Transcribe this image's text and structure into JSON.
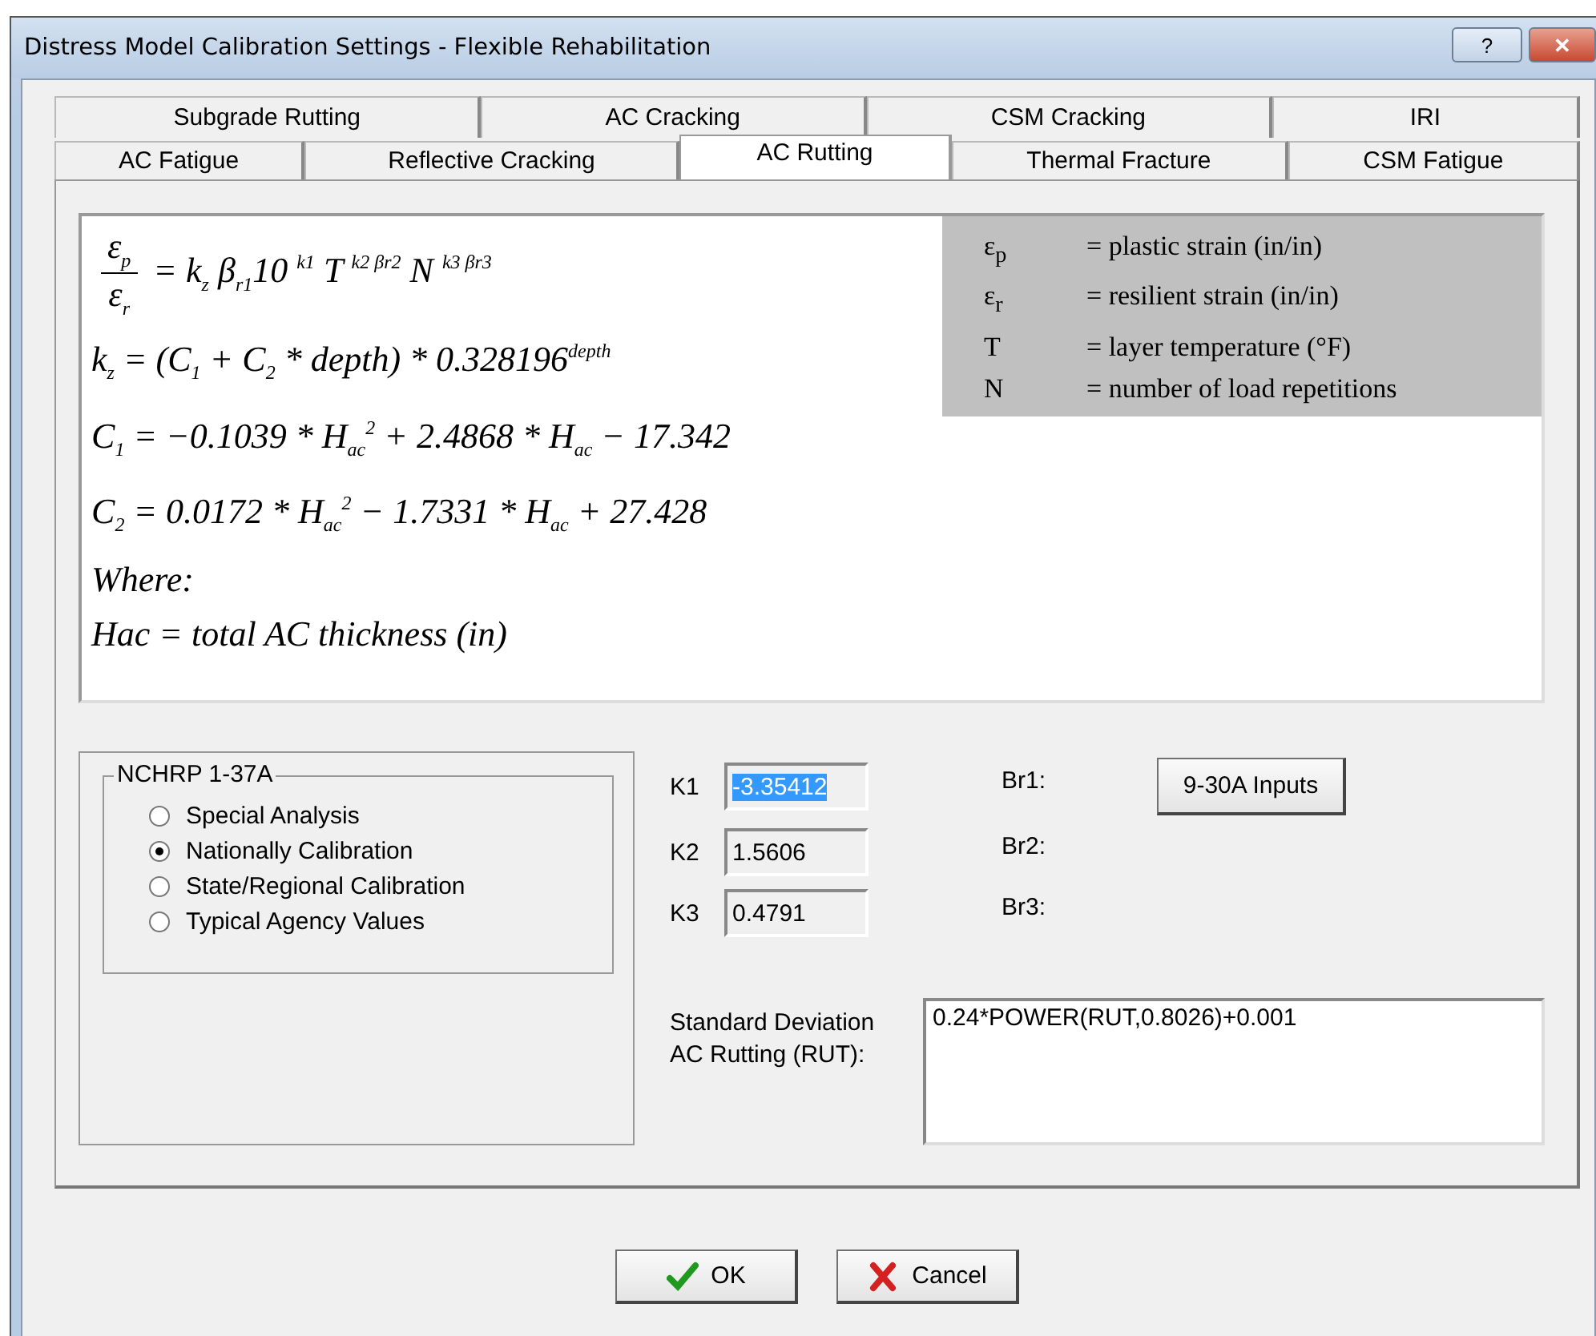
{
  "window": {
    "title": "Distress Model Calibration Settings - Flexible Rehabilitation",
    "buttons": [
      {
        "kind": "help",
        "label": "?"
      },
      {
        "kind": "close",
        "label": "✕"
      }
    ]
  },
  "tab_rows": [
    [
      {
        "label": "Subgrade Rutting",
        "selected": false
      },
      {
        "label": "AC Cracking",
        "selected": false
      },
      {
        "label": "CSM Cracking",
        "selected": false
      },
      {
        "label": "IRI",
        "selected": false
      }
    ],
    [
      {
        "label": "AC Fatigue",
        "selected": false
      },
      {
        "label": "Reflective Cracking",
        "selected": false
      },
      {
        "label": "AC Rutting",
        "selected": true
      },
      {
        "label": "Thermal Fracture",
        "selected": false
      },
      {
        "label": "CSM Fatigue",
        "selected": false
      }
    ]
  ],
  "equations": [
    {
      "kind": "fraction",
      "numerator": "ε$_{p}$",
      "denominator": "ε$_{r}$",
      "rest": "= k$_{z}$ β$_{r1}$10 $^{k1}$ T $^{k2 βr2}$ N $^{k3 βr3}$"
    },
    {
      "kind": "line",
      "text": "k$_{z}$ = (C$_{1}$ + C$_{2}$ * depth) * 0.328196$^{depth}$"
    },
    {
      "kind": "line",
      "text": "C$_{1}$ = −0.1039 * H$_{ac}$$^{2}$ + 2.4868 * H$_{ac}$ − 17.342"
    },
    {
      "kind": "line",
      "text": "C$_{2}$ = 0.0172 * H$_{ac}$$^{2}$ − 1.7331 * H$_{ac}$ + 27.428"
    },
    {
      "kind": "italic",
      "text": "Where:"
    },
    {
      "kind": "line",
      "text": "*Hac* = total AC thickness (in)"
    }
  ],
  "legend": [
    {
      "symbol": "ε$_{p}$",
      "text": "= plastic strain (in/in)"
    },
    {
      "symbol": "ε$_{r}$",
      "text": "= resilient strain (in/in)"
    },
    {
      "symbol": "T",
      "text": "= layer temperature (°F)"
    },
    {
      "symbol": "N",
      "text": "= number of load repetitions"
    }
  ],
  "calibration": {
    "title": "NCHRP 1-37A",
    "options": [
      {
        "label": "Special Analysis",
        "selected": false
      },
      {
        "label": "Nationally Calibration",
        "selected": true
      },
      {
        "label": "State/Regional Calibration",
        "selected": false
      },
      {
        "label": "Typical Agency Values",
        "selected": false
      }
    ]
  },
  "coefficients": [
    {
      "label": "K1",
      "value": "-3.35412",
      "selected": true,
      "beta": "Br1:"
    },
    {
      "label": "K2",
      "value": "1.5606",
      "selected": false,
      "beta": "Br2:"
    },
    {
      "label": "K3",
      "value": "0.4791",
      "selected": false,
      "beta": "Br3:"
    }
  ],
  "inputs_button": "9-30A Inputs",
  "std_dev": {
    "label": "Standard Deviation AC Rutting  (RUT):",
    "value": "0.24*POWER(RUT,0.8026)+0.001"
  },
  "footer_buttons": [
    {
      "kind": "ok",
      "label": "OK"
    },
    {
      "kind": "cancel",
      "label": "Cancel"
    }
  ]
}
